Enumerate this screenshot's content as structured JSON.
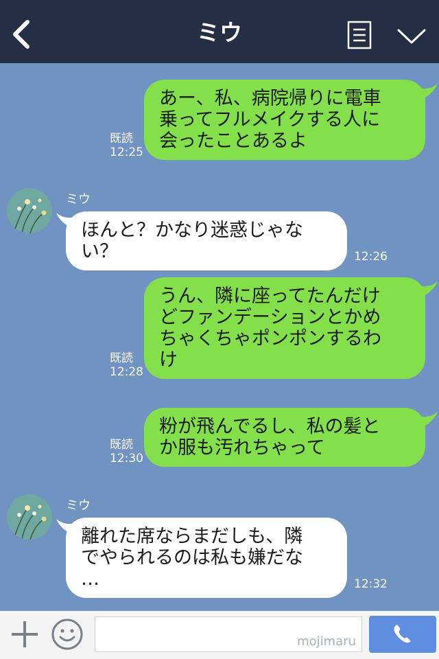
{
  "header": {
    "title": "ミウ"
  },
  "messages": [
    {
      "side": "me",
      "text": "あー、私、病院帰りに電車乗ってフルメイクする人に会ったことあるよ",
      "lines": [
        "あー、私、病院帰りに電車",
        "乗ってフルメイクする人に",
        "会ったことあるよ"
      ],
      "read": "既読",
      "time": "12:25"
    },
    {
      "side": "them",
      "sender": "ミウ",
      "text": "ほんと？かなり迷惑じゃない？",
      "lines": [
        "ほんと？かなり迷惑じゃな",
        "い？"
      ],
      "time": "12:26"
    },
    {
      "side": "me",
      "text": "うん、隣に座ってたんだけどファンデーションとかめちゃくちゃポンポンするわけ",
      "lines": [
        "うん、隣に座ってたんだけ",
        "どファンデーションとかめ",
        "ちゃくちゃポンポンするわ",
        "け"
      ],
      "read": "既読",
      "time": "12:28"
    },
    {
      "side": "me",
      "text": "粉が飛んでるし、私の髪とか服も汚れちゃって",
      "lines": [
        "粉が飛んでるし、私の髪と",
        "か服も汚れちゃって"
      ],
      "read": "既読",
      "time": "12:30"
    },
    {
      "side": "them",
      "sender": "ミウ",
      "text": "離れた席ならまだしも、隣でやられるのは私も嫌だな…",
      "lines": [
        "離れた席ならまだしも、隣",
        "でやられるのは私も嫌だな",
        "…"
      ],
      "time": "12:32"
    }
  ],
  "input": {
    "watermark": "mojimaru"
  },
  "colors": {
    "header": "#242e45",
    "chat_bg": "#7093c2",
    "my_bubble": "#84e04a",
    "their_bubble": "#ffffff",
    "call_button": "#5f8de0"
  },
  "icons": {
    "back": "chevron-left-icon",
    "memo": "note-icon",
    "collapse": "chevron-down-icon",
    "add": "plus-icon",
    "sticker": "smile-icon",
    "call": "phone-icon"
  }
}
